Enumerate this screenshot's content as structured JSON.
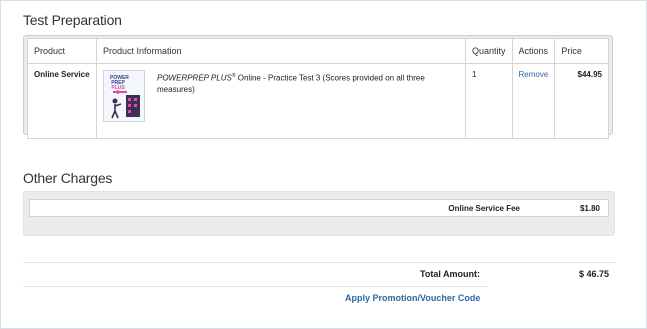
{
  "sections": {
    "test_prep_title": "Test Preparation",
    "other_charges_title": "Other Charges"
  },
  "table": {
    "headers": {
      "product": "Product",
      "info": "Product Information",
      "quantity": "Quantity",
      "actions": "Actions",
      "price": "Price"
    },
    "row": {
      "product": "Online Service",
      "info_brand": "POWERPREP PLUS",
      "info_reg": "®",
      "info_rest": " Online - Practice Test 3 (Scores provided on all three measures)",
      "thumb_line1": "POWER",
      "thumb_line2": "PREP",
      "thumb_line3": "PLUS 3",
      "quantity": "1",
      "action": "Remove",
      "price": "$44.95"
    }
  },
  "other_charges": {
    "label": "Online Service Fee",
    "value": "$1.80"
  },
  "totals": {
    "label": "Total Amount:",
    "value": "$ 46.75"
  },
  "promo_link": "Apply Promotion/Voucher Code",
  "colors": {
    "link": "#2b6aa3",
    "accent_pink": "#d44a9d",
    "purple": "#3a3f8f"
  }
}
